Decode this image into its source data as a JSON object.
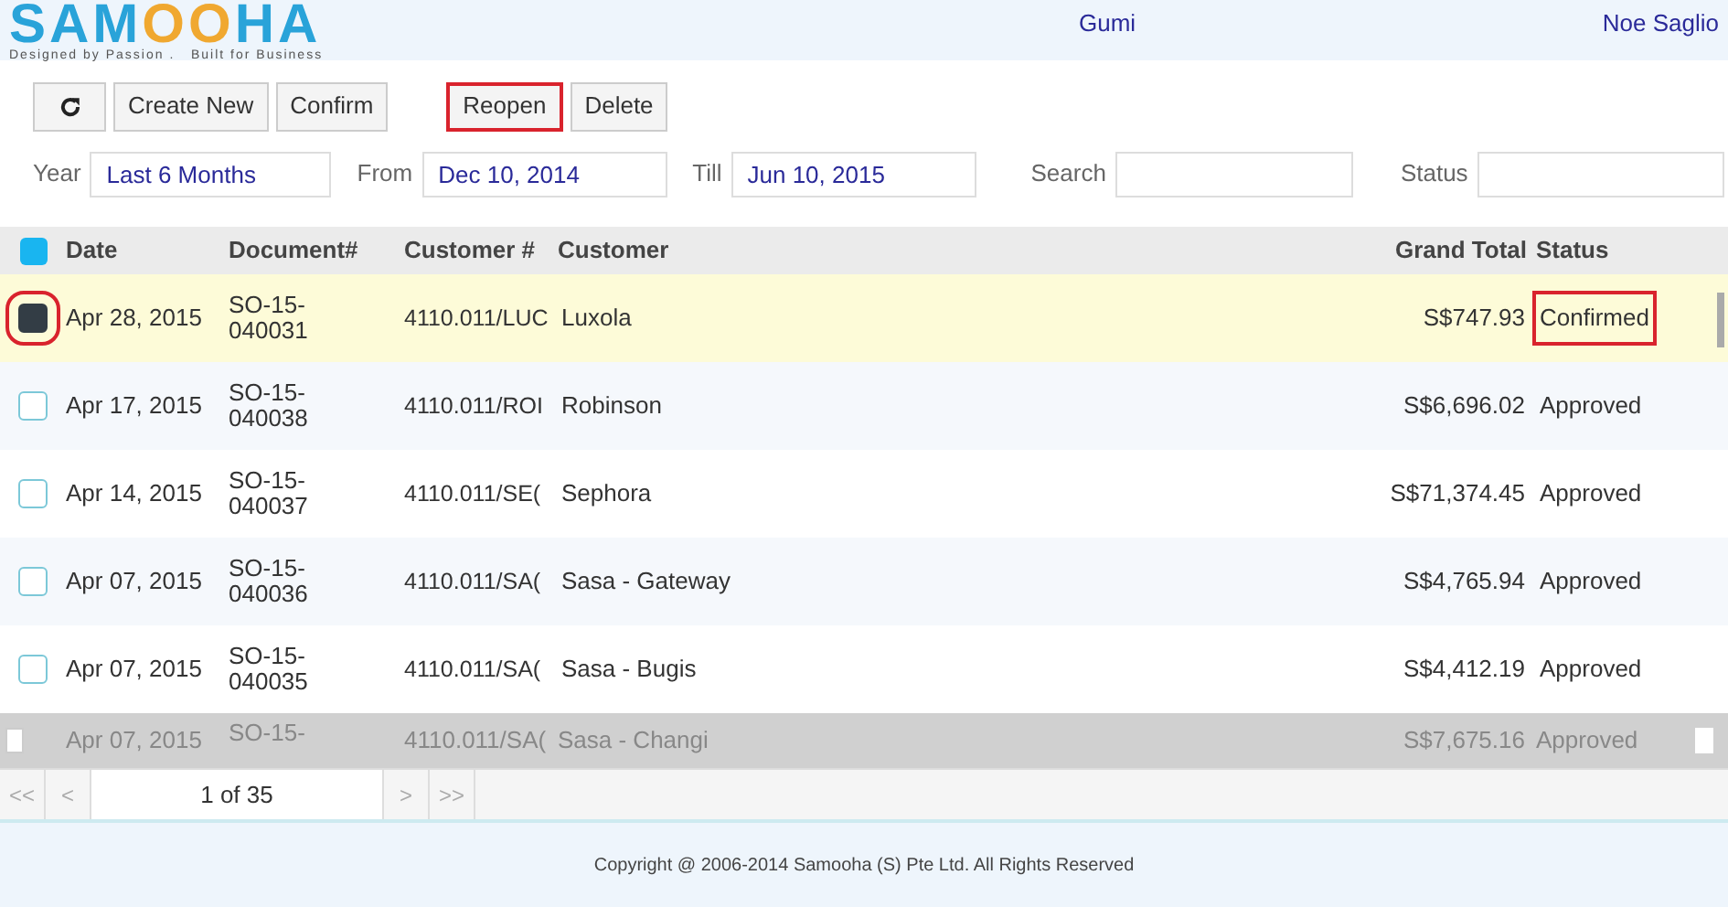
{
  "logo": {
    "parts": [
      "SAM",
      "OO",
      "HA"
    ],
    "tagline": "Designed by Passion .   Built for Business"
  },
  "header": {
    "company": "Gumi",
    "user": "Noe Saglio"
  },
  "toolbar": [
    {
      "kind": "refresh",
      "highlighted": false
    },
    {
      "kind": "button",
      "label": "Create New",
      "highlighted": false
    },
    {
      "kind": "button",
      "label": "Confirm",
      "highlighted": false
    },
    {
      "kind": "button",
      "label": "Reopen",
      "highlighted": true
    },
    {
      "kind": "button",
      "label": "Delete",
      "highlighted": false
    }
  ],
  "filters": [
    {
      "label": "Year",
      "value": "Last 6 Months"
    },
    {
      "label": "From",
      "value": "Dec 10, 2014"
    },
    {
      "label": "Till",
      "value": "Jun 10, 2015"
    },
    {
      "label": "Search"
    },
    {
      "label": "Status"
    }
  ],
  "table": {
    "select_all_checked": true,
    "columns": [
      "Date",
      "Document#",
      "Customer #",
      "Customer",
      "Grand Total",
      "Status"
    ],
    "rows": [
      {
        "selected": true,
        "highlighted": true,
        "date": "Apr 28, 2015",
        "document": [
          "SO-15-",
          "040031"
        ],
        "customer_no": "4110.011/LUC",
        "customer": "Luxola",
        "total": "S$747.93",
        "status": "Confirmed"
      },
      {
        "selected": false,
        "highlighted": false,
        "date": "Apr 17, 2015",
        "document": [
          "SO-15-",
          "040038"
        ],
        "customer_no": "4110.011/ROI",
        "customer": "Robinson",
        "total": "S$6,696.02",
        "status": "Approved"
      },
      {
        "selected": false,
        "highlighted": false,
        "date": "Apr 14, 2015",
        "document": [
          "SO-15-",
          "040037"
        ],
        "customer_no": "4110.011/SE(",
        "customer": "Sephora",
        "total": "S$71,374.45",
        "status": "Approved"
      },
      {
        "selected": false,
        "highlighted": false,
        "date": "Apr 07, 2015",
        "document": [
          "SO-15-",
          "040036"
        ],
        "customer_no": "4110.011/SA(",
        "customer": "Sasa - Gateway",
        "total": "S$4,765.94",
        "status": "Approved"
      },
      {
        "selected": false,
        "highlighted": false,
        "date": "Apr 07, 2015",
        "document": [
          "SO-15-",
          "040035"
        ],
        "customer_no": "4110.011/SA(",
        "customer": "Sasa - Bugis",
        "total": "S$4,412.19",
        "status": "Approved"
      }
    ],
    "partial_row": {
      "date": "Apr 07, 2015",
      "document": "SO-15-",
      "customer_no": "4110.011/SA(",
      "customer": "Sasa - Changi",
      "total": "S$7,675.16",
      "status": "Approved"
    }
  },
  "pager": {
    "first": "<<",
    "prev": "<",
    "page": "1 of 35",
    "next": ">",
    "last": ">>"
  },
  "footer": "Copyright @ 2006-2014 Samooha (S) Pte Ltd. All Rights Reserved"
}
